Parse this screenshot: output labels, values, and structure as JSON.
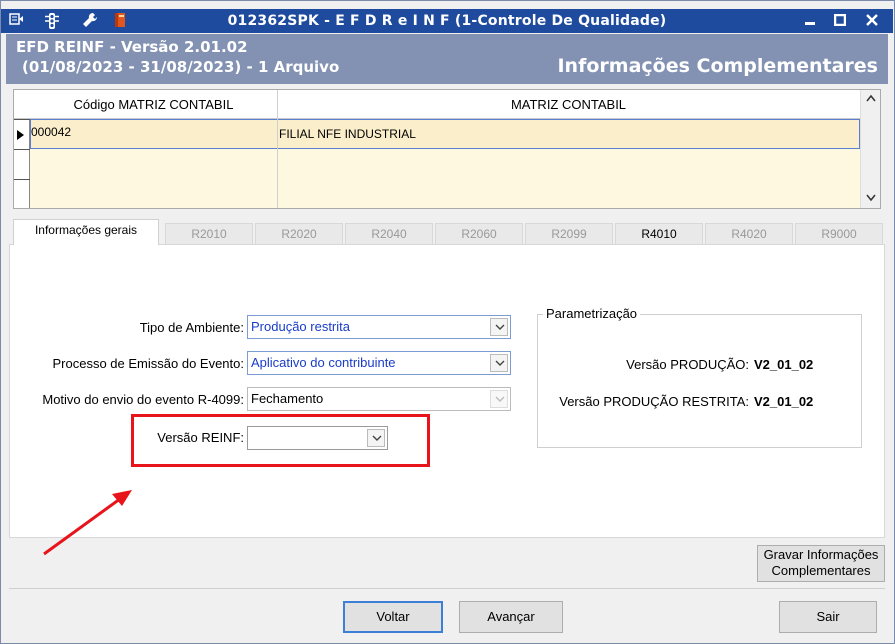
{
  "window": {
    "title": "012362SPK - E F D  R e I N F (1-Controle De Qualidade)"
  },
  "header": {
    "line1": "EFD REINF - Versão 2.01.02",
    "line2": "(01/08/2023 - 31/08/2023) - 1 Arquivo",
    "right_title": "Informações Complementares"
  },
  "grid": {
    "columns": [
      "Código MATRIZ CONTABIL",
      "MATRIZ CONTABIL"
    ],
    "rows": [
      {
        "codigo": "000042",
        "matriz": "FILIAL NFE INDUSTRIAL"
      }
    ]
  },
  "tabs": [
    {
      "label": "Informações gerais",
      "active": true
    },
    {
      "label": "R2010"
    },
    {
      "label": "R2020"
    },
    {
      "label": "R2040"
    },
    {
      "label": "R2060"
    },
    {
      "label": "R2099"
    },
    {
      "label": "R4010",
      "enabled": true
    },
    {
      "label": "R4020"
    },
    {
      "label": "R9000"
    }
  ],
  "form": {
    "tipo_ambiente_label": "Tipo de Ambiente:",
    "tipo_ambiente_value": "Produção restrita",
    "processo_label": "Processo de Emissão do Evento:",
    "processo_value": "Aplicativo do contribuinte",
    "motivo_label": "Motivo do envio do evento R-4099:",
    "motivo_value": "Fechamento",
    "versao_label": "Versão REINF:",
    "versao_value": ""
  },
  "parametrizacao": {
    "title": "Parametrização",
    "producao_label": "Versão PRODUÇÃO:",
    "producao_value": "V2_01_02",
    "restrita_label": "Versão PRODUÇÃO RESTRITA:",
    "restrita_value": "V2_01_02"
  },
  "buttons": {
    "gravar_line1": "Gravar Informações",
    "gravar_line2": "Complementares",
    "voltar": "Voltar",
    "avancar": "Avançar",
    "sair": "Sair"
  },
  "colors": {
    "titlebar": "#1e4b9e",
    "header": "#8391b3",
    "highlight": "#e8141b"
  }
}
